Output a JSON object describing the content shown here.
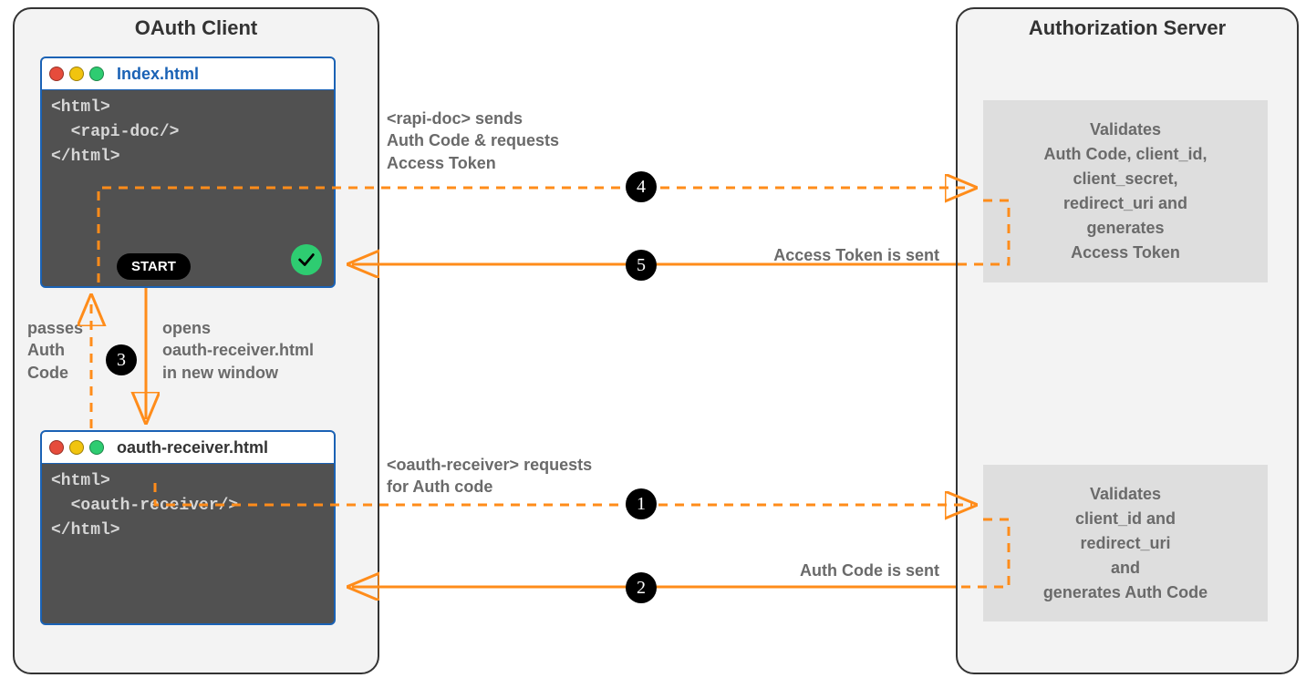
{
  "client_panel": {
    "title": "OAuth Client"
  },
  "server_panel": {
    "title": "Authorization Server"
  },
  "window_index": {
    "title": "Index.html",
    "code": "<html>\n  <rapi-doc/>\n</html>"
  },
  "window_receiver": {
    "title": "oauth-receiver.html",
    "code": "<html>\n  <oauth-receiver/>\n</html>"
  },
  "start_label": "START",
  "server_box_top": "Validates\nAuth Code, client_id,\nclient_secret,\nredirect_uri and\ngenerates\nAccess Token",
  "server_box_bottom": "Validates\nclient_id and\nredirect_uri\nand\ngenerates Auth Code",
  "labels": {
    "passes_auth_code": "passes\nAuth\nCode",
    "opens_receiver": "opens\noauth-receiver.html\nin new window",
    "rapidoc_sends": "<rapi-doc> sends\nAuth Code & requests\nAccess Token",
    "access_token_sent": "Access Token is sent",
    "receiver_requests": "<oauth-receiver> requests\nfor Auth code",
    "auth_code_sent": "Auth Code is sent"
  },
  "steps": {
    "s1": "1",
    "s2": "2",
    "s3": "3",
    "s4": "4",
    "s5": "5"
  }
}
